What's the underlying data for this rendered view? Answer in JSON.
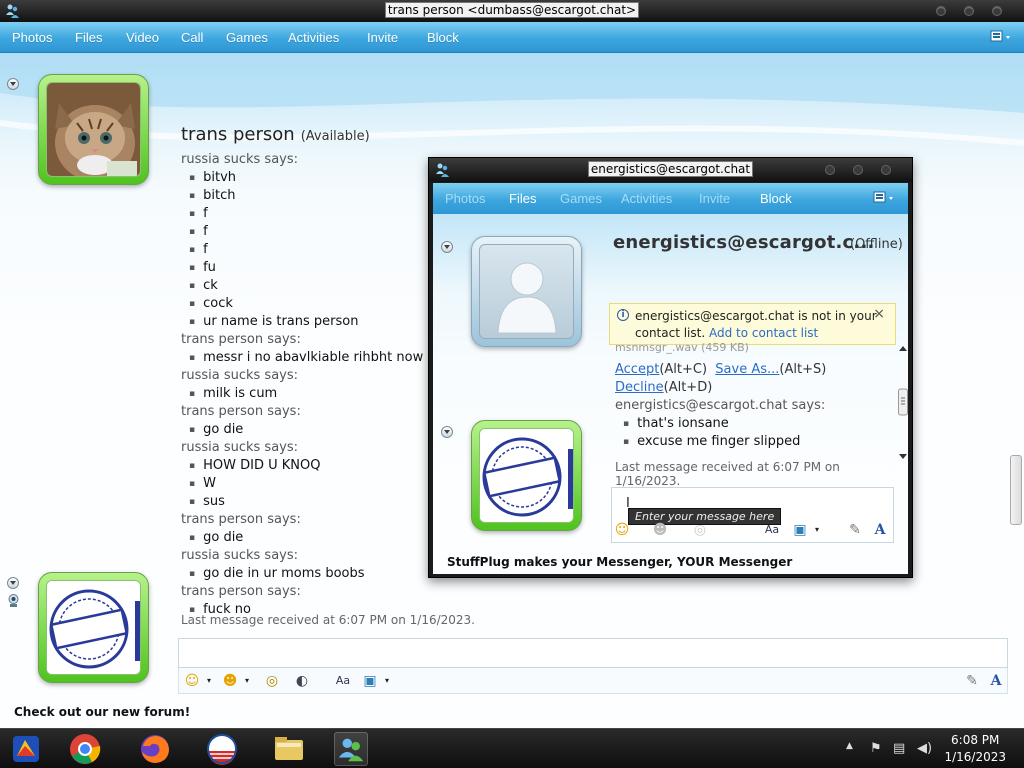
{
  "window": {
    "title": "trans person <dumbass@escargot.chat>"
  },
  "menu": [
    "Photos",
    "Files",
    "Video",
    "Call",
    "Games",
    "Activities",
    "Invite",
    "Block"
  ],
  "contact": {
    "name": "trans person",
    "status": "(Available)"
  },
  "transcript": [
    {
      "type": "says",
      "text": "russia sucks says:"
    },
    {
      "type": "msg",
      "text": "bitvh"
    },
    {
      "type": "msg",
      "text": "bitch"
    },
    {
      "type": "msg",
      "text": "f"
    },
    {
      "type": "msg",
      "text": "f"
    },
    {
      "type": "msg",
      "text": "f"
    },
    {
      "type": "msg",
      "text": "fu"
    },
    {
      "type": "msg",
      "text": "ck"
    },
    {
      "type": "msg",
      "text": "cock"
    },
    {
      "type": "msg",
      "text": "ur name is trans person"
    },
    {
      "type": "says",
      "text": "trans person says:"
    },
    {
      "type": "msg",
      "text": "messr i no abavlkiable rihbht now"
    },
    {
      "type": "says",
      "text": "russia sucks says:"
    },
    {
      "type": "msg",
      "text": "milk is cum"
    },
    {
      "type": "says",
      "text": "trans person says:"
    },
    {
      "type": "msg",
      "text": "go die"
    },
    {
      "type": "says",
      "text": "russia sucks says:"
    },
    {
      "type": "msg",
      "text": "HOW DID U KNOQ"
    },
    {
      "type": "msg",
      "text": "W"
    },
    {
      "type": "msg",
      "text": "sus"
    },
    {
      "type": "says",
      "text": "trans person says:"
    },
    {
      "type": "msg",
      "text": "go die"
    },
    {
      "type": "says",
      "text": "russia sucks says:"
    },
    {
      "type": "msg",
      "text": "go die in ur moms boobs"
    },
    {
      "type": "says",
      "text": "trans person says:"
    },
    {
      "type": "msg",
      "text": "fuck no"
    }
  ],
  "last_received": "Last message received at 6:07 PM on 1/16/2023.",
  "footer": "Check out our new forum!",
  "sub_window": {
    "title": "energistics@escargot.chat",
    "menu": [
      {
        "label": "Photos",
        "enabled": false
      },
      {
        "label": "Files",
        "enabled": true
      },
      {
        "label": "Games",
        "enabled": false
      },
      {
        "label": "Activities",
        "enabled": false
      },
      {
        "label": "Invite",
        "enabled": false
      },
      {
        "label": "Block",
        "enabled": true
      }
    ],
    "contact_name": "energistics@escargot.c...",
    "status": "(Offline)",
    "info_text": "energistics@escargot.chat is not in your contact list.",
    "info_link": "Add to contact list",
    "file_line": "msnmsgr_.wav (459 KB)",
    "accept": "Accept",
    "accept_key": "(Alt+C)",
    "save_as": "Save As...",
    "save_key": "(Alt+S)",
    "decline": "Decline",
    "decline_key": "(Alt+D)",
    "says": "energistics@escargot.chat says:",
    "messages": [
      "that's ionsane",
      "excuse me finger slipped"
    ],
    "last_received": "Last message received at 6:07 PM on 1/16/2023.",
    "input_placeholder": "Enter your message here",
    "footer": "StuffPlug makes your Messenger, YOUR Messenger"
  },
  "taskbar": {
    "time": "6:08 PM",
    "date": "1/16/2023"
  },
  "colors": {
    "menubar": "#3da6de",
    "avatar_frame": "#4fc31f",
    "link": "#2d6cc6"
  }
}
